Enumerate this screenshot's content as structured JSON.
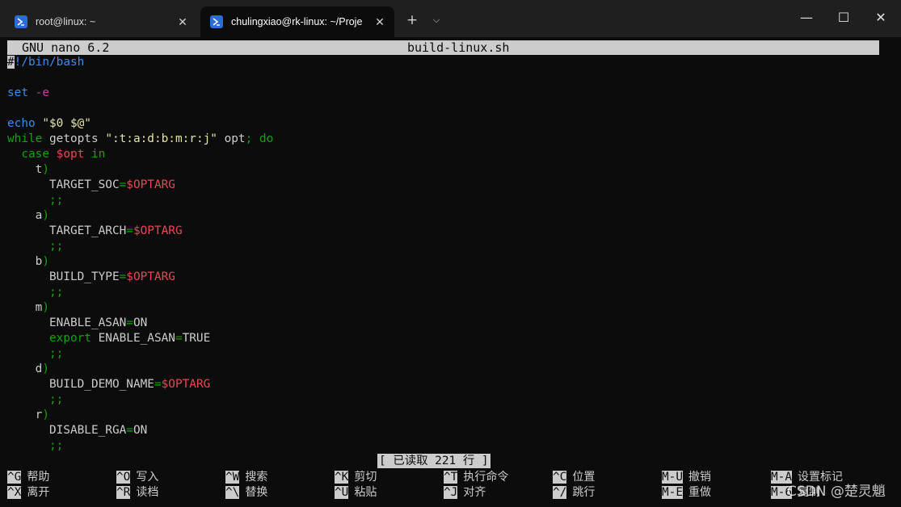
{
  "tabs": [
    {
      "title": "root@linux: ~",
      "active": false
    },
    {
      "title": "chulingxiao@rk-linux: ~/Proje",
      "active": true
    }
  ],
  "window_controls": {
    "new_tab": "+",
    "dropdown": "⌵",
    "minimize": "—",
    "maximize": "☐",
    "close": "✕"
  },
  "nano": {
    "version": "GNU nano 6.2",
    "filename": "build-linux.sh",
    "lines": [
      [
        {
          "t": "#",
          "c": "cursor"
        },
        {
          "t": "!/bin/bash",
          "c": "c-blue"
        }
      ],
      [],
      [
        {
          "t": "set",
          "c": "c-blue"
        },
        {
          "t": " -e",
          "c": "c-magenta"
        }
      ],
      [],
      [
        {
          "t": "echo",
          "c": "c-blue"
        },
        {
          "t": " ",
          "c": "c-white"
        },
        {
          "t": "\"$0 $@\"",
          "c": "c-yellow"
        }
      ],
      [
        {
          "t": "while",
          "c": "c-green"
        },
        {
          "t": " getopts ",
          "c": "c-white"
        },
        {
          "t": "\":t:a:d:b:m:r:j\"",
          "c": "c-yellow"
        },
        {
          "t": " opt",
          "c": "c-white"
        },
        {
          "t": "; do",
          "c": "c-green"
        }
      ],
      [
        {
          "t": "  case",
          "c": "c-green"
        },
        {
          "t": " ",
          "c": "c-white"
        },
        {
          "t": "$opt",
          "c": "c-red"
        },
        {
          "t": " in",
          "c": "c-green"
        }
      ],
      [
        {
          "t": "    t",
          "c": "c-white"
        },
        {
          "t": ")",
          "c": "c-green"
        }
      ],
      [
        {
          "t": "      TARGET_SOC",
          "c": "c-white"
        },
        {
          "t": "=",
          "c": "c-green"
        },
        {
          "t": "$OPTARG",
          "c": "c-red"
        }
      ],
      [
        {
          "t": "      ;;",
          "c": "c-green"
        }
      ],
      [
        {
          "t": "    a",
          "c": "c-white"
        },
        {
          "t": ")",
          "c": "c-green"
        }
      ],
      [
        {
          "t": "      TARGET_ARCH",
          "c": "c-white"
        },
        {
          "t": "=",
          "c": "c-green"
        },
        {
          "t": "$OPTARG",
          "c": "c-red"
        }
      ],
      [
        {
          "t": "      ;;",
          "c": "c-green"
        }
      ],
      [
        {
          "t": "    b",
          "c": "c-white"
        },
        {
          "t": ")",
          "c": "c-green"
        }
      ],
      [
        {
          "t": "      BUILD_TYPE",
          "c": "c-white"
        },
        {
          "t": "=",
          "c": "c-green"
        },
        {
          "t": "$OPTARG",
          "c": "c-red"
        }
      ],
      [
        {
          "t": "      ;;",
          "c": "c-green"
        }
      ],
      [
        {
          "t": "    m",
          "c": "c-white"
        },
        {
          "t": ")",
          "c": "c-green"
        }
      ],
      [
        {
          "t": "      ENABLE_ASAN",
          "c": "c-white"
        },
        {
          "t": "=",
          "c": "c-green"
        },
        {
          "t": "ON",
          "c": "c-white"
        }
      ],
      [
        {
          "t": "      export",
          "c": "c-green"
        },
        {
          "t": " ENABLE_ASAN",
          "c": "c-white"
        },
        {
          "t": "=",
          "c": "c-green"
        },
        {
          "t": "TRUE",
          "c": "c-white"
        }
      ],
      [
        {
          "t": "      ;;",
          "c": "c-green"
        }
      ],
      [
        {
          "t": "    d",
          "c": "c-white"
        },
        {
          "t": ")",
          "c": "c-green"
        }
      ],
      [
        {
          "t": "      BUILD_DEMO_NAME",
          "c": "c-white"
        },
        {
          "t": "=",
          "c": "c-green"
        },
        {
          "t": "$OPTARG",
          "c": "c-red"
        }
      ],
      [
        {
          "t": "      ;;",
          "c": "c-green"
        }
      ],
      [
        {
          "t": "    r",
          "c": "c-white"
        },
        {
          "t": ")",
          "c": "c-green"
        }
      ],
      [
        {
          "t": "      DISABLE_RGA",
          "c": "c-white"
        },
        {
          "t": "=",
          "c": "c-green"
        },
        {
          "t": "ON",
          "c": "c-white"
        }
      ],
      [
        {
          "t": "      ;;",
          "c": "c-green"
        }
      ]
    ],
    "status": "[ 已读取 221 行 ]",
    "shortcuts_row1": [
      {
        "key": "^G",
        "label": "帮助"
      },
      {
        "key": "^O",
        "label": "写入"
      },
      {
        "key": "^W",
        "label": "搜索"
      },
      {
        "key": "^K",
        "label": "剪切"
      },
      {
        "key": "^T",
        "label": "执行命令"
      },
      {
        "key": "^C",
        "label": "位置"
      },
      {
        "key": "M-U",
        "label": "撤销"
      },
      {
        "key": "M-A",
        "label": "设置标记"
      }
    ],
    "shortcuts_row2": [
      {
        "key": "^X",
        "label": "离开"
      },
      {
        "key": "^R",
        "label": "读档"
      },
      {
        "key": "^\\",
        "label": "替换"
      },
      {
        "key": "^U",
        "label": "粘贴"
      },
      {
        "key": "^J",
        "label": "对齐"
      },
      {
        "key": "^/",
        "label": "跳行"
      },
      {
        "key": "M-E",
        "label": "重做"
      },
      {
        "key": "M-6",
        "label": "复制"
      }
    ]
  },
  "watermark": "CSDN @楚灵魈"
}
